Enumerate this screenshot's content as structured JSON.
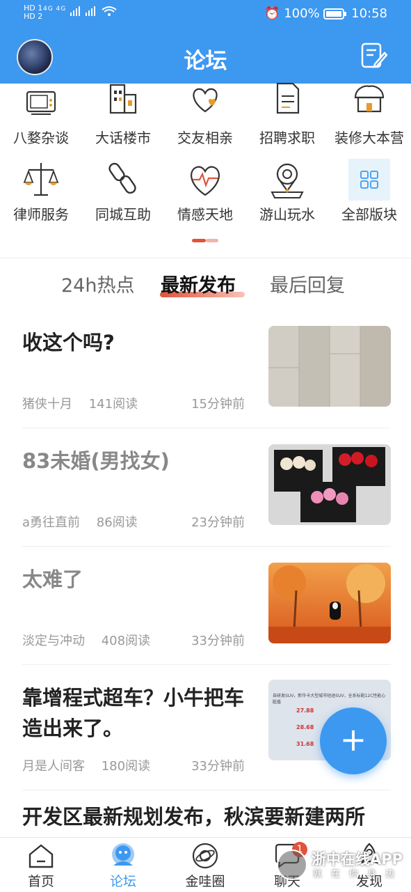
{
  "status_bar": {
    "sim1": "HD 1",
    "sim2": "HD 2",
    "signal": "4G 4G",
    "battery": "100%",
    "time": "10:58"
  },
  "app_bar": {
    "title": "论坛"
  },
  "categories": [
    {
      "label": "八婺杂谈",
      "icon": "tv-icon"
    },
    {
      "label": "大话楼市",
      "icon": "building-icon"
    },
    {
      "label": "交友相亲",
      "icon": "heart-icon"
    },
    {
      "label": "招聘求职",
      "icon": "document-icon"
    },
    {
      "label": "装修大本营",
      "icon": "house-icon"
    },
    {
      "label": "律师服务",
      "icon": "scales-icon"
    },
    {
      "label": "同城互助",
      "icon": "link-icon"
    },
    {
      "label": "情感天地",
      "icon": "heartbeat-icon"
    },
    {
      "label": "游山玩水",
      "icon": "map-pin-icon"
    },
    {
      "label": "全部版块",
      "icon": "grid-icon"
    }
  ],
  "tabs": [
    {
      "label": "24h热点"
    },
    {
      "label": "最新发布",
      "active": true
    },
    {
      "label": "最后回复"
    }
  ],
  "posts": [
    {
      "title": "收这个吗?",
      "author": "猪侠十月",
      "reads": "141阅读",
      "time": "15分钟前",
      "read": false
    },
    {
      "title": "83未婚(男找女)",
      "author": "a勇往直前",
      "reads": "86阅读",
      "time": "23分钟前",
      "read": true
    },
    {
      "title": "太难了",
      "author": "淡定与冲动",
      "reads": "408阅读",
      "time": "33分钟前",
      "read": true
    },
    {
      "title": "靠增程式超车？小牛把车造出来了。",
      "author": "月是人间客",
      "reads": "180阅读",
      "time": "33分钟前",
      "read": false
    },
    {
      "title": "开发区最新规划发布，秋滨要新建两所"
    }
  ],
  "thumb4_text": {
    "line1": "自研发SUV，新华卡大型城市短途SUV，全系标配12C性能心脏盾",
    "v1": "27.88",
    "v2": "28.68",
    "v3": "31.68"
  },
  "fab": {
    "label": "+"
  },
  "bottom_nav": [
    {
      "label": "首页",
      "icon": "home-icon"
    },
    {
      "label": "论坛",
      "icon": "forum-icon",
      "active": true
    },
    {
      "label": "金哇圈",
      "icon": "planet-icon"
    },
    {
      "label": "聊天",
      "icon": "chat-icon",
      "badge": "1"
    },
    {
      "label": "发现",
      "icon": "rocket-icon"
    }
  ],
  "watermark": {
    "line1": "浙中在线APP",
    "line2": "就在你身边"
  },
  "colors": {
    "primary": "#3D98F0",
    "accent": "#E0533B"
  }
}
